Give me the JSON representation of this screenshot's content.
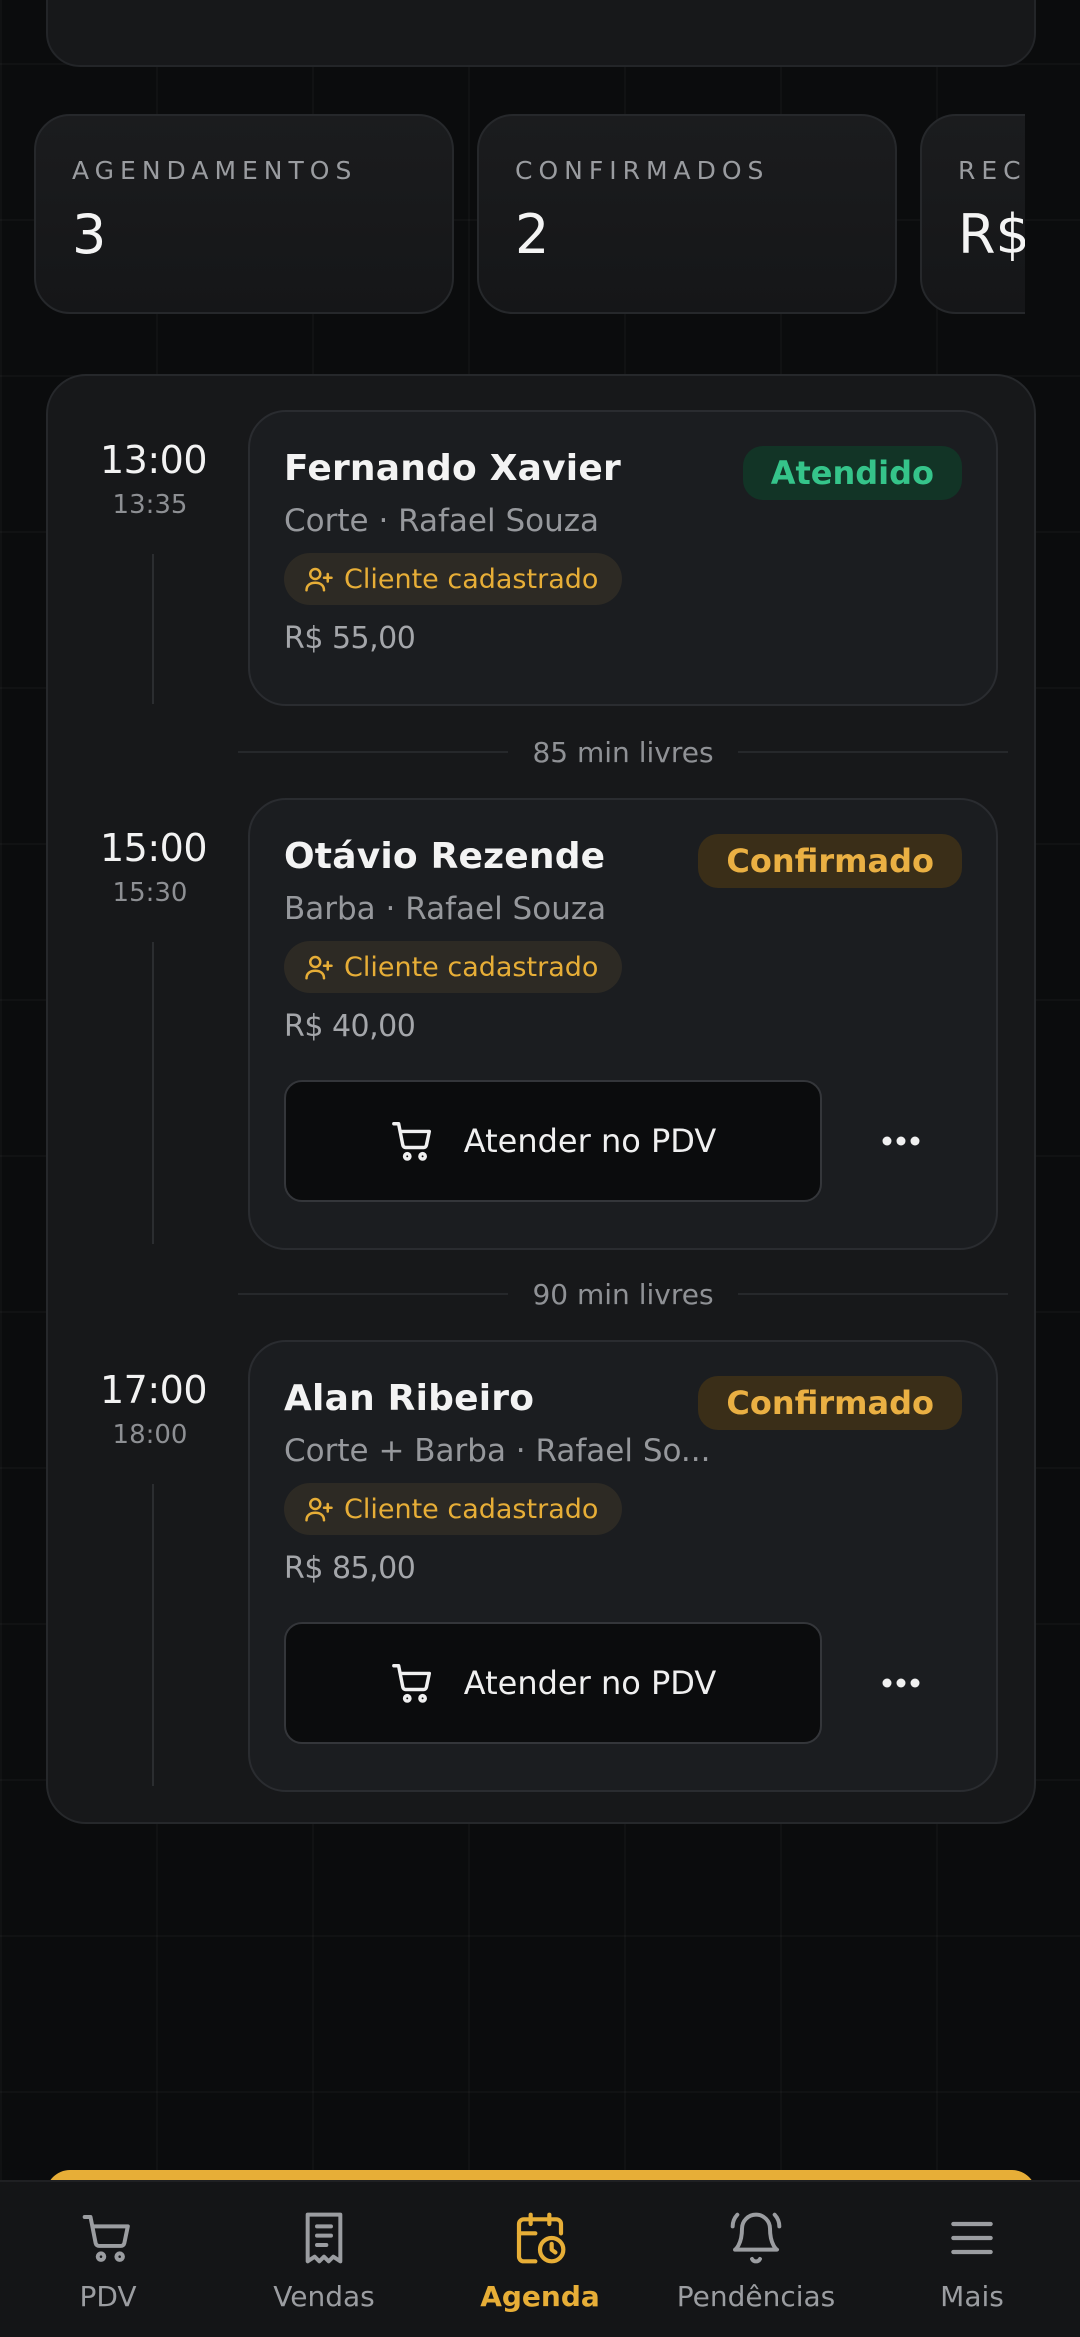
{
  "theme": {
    "accent": "#e7ae37",
    "success": "#35c48a",
    "background": "#0b0c0d"
  },
  "stats": [
    {
      "label": "AGENDAMENTOS",
      "value": "3"
    },
    {
      "label": "CONFIRMADOS",
      "value": "2"
    },
    {
      "label": "REC",
      "value": "R$"
    }
  ],
  "appointments": [
    {
      "start": "13:00",
      "end": "13:35",
      "client": "Fernando Xavier",
      "status": "Atendido",
      "service": "Corte · Rafael Souza",
      "tag": "Cliente cadastrado",
      "price": "R$ 55,00"
    },
    {
      "start": "15:00",
      "end": "15:30",
      "client": "Otávio Rezende",
      "status": "Confirmado",
      "service": "Barba · Rafael Souza",
      "tag": "Cliente cadastrado",
      "price": "R$ 40,00",
      "action": "Atender no PDV"
    },
    {
      "start": "17:00",
      "end": "18:00",
      "client": "Alan Ribeiro",
      "status": "Confirmado",
      "service": "Corte + Barba · Rafael So...",
      "tag": "Cliente cadastrado",
      "price": "R$ 85,00",
      "action": "Atender no PDV"
    }
  ],
  "gaps": [
    "85 min livres",
    "90 min livres"
  ],
  "nav": [
    {
      "label": "PDV",
      "icon": "cart-icon",
      "active": false
    },
    {
      "label": "Vendas",
      "icon": "receipt-icon",
      "active": false
    },
    {
      "label": "Agenda",
      "icon": "calendar-clock-icon",
      "active": true
    },
    {
      "label": "Pendências",
      "icon": "bell-icon",
      "active": false
    },
    {
      "label": "Mais",
      "icon": "menu-icon",
      "active": false
    }
  ]
}
